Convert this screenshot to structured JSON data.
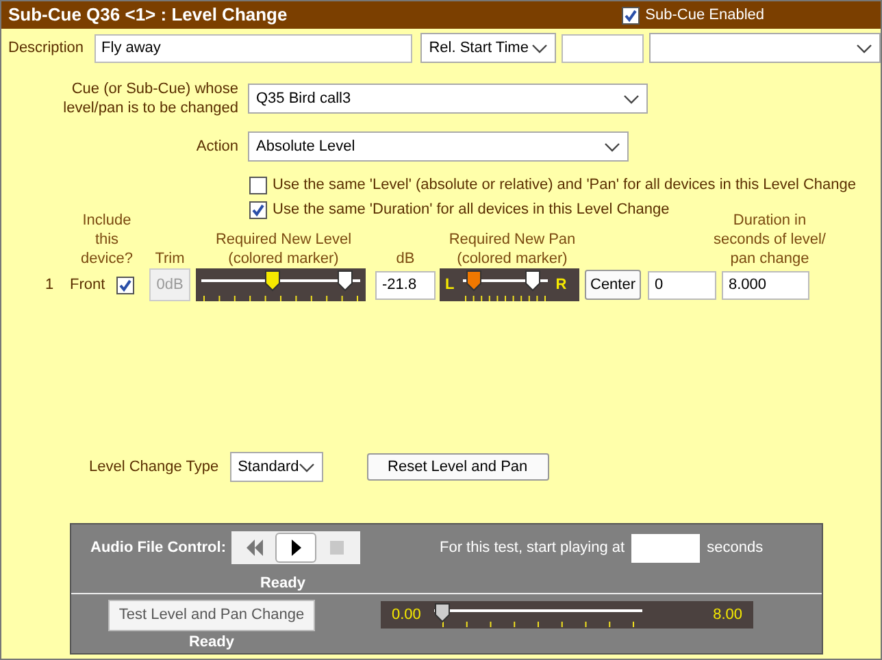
{
  "window": {
    "title": "Sub-Cue Q36 <1> : Level Change"
  },
  "enabled": {
    "label": "Sub-Cue Enabled",
    "checked": true
  },
  "description": {
    "label": "Description",
    "value": "Fly away"
  },
  "start": {
    "mode": "Rel. Start Time"
  },
  "cue": {
    "label": "Cue (or Sub-Cue) whose level/pan is to be changed",
    "value": "Q35  Bird call3"
  },
  "action": {
    "label": "Action",
    "value": "Absolute Level"
  },
  "options": [
    {
      "label": "Use the same 'Level' (absolute or relative) and 'Pan' for all devices in this Level Change",
      "checked": false
    },
    {
      "label": "Use the same 'Duration' for all devices in this Level Change",
      "checked": true
    }
  ],
  "columns": [
    "Include this device?",
    "Trim",
    "Required New Level (colored marker)",
    "dB",
    "Required New Pan (colored marker)",
    "Duration in seconds of level/ pan change"
  ],
  "devices": [
    {
      "number": "1",
      "name": "Front",
      "included": true,
      "trim": "0dB",
      "new_level": {
        "level": 0.45
      },
      "current_level": {
        "level": 0.92
      },
      "db": "-21.8",
      "pan_left": "L",
      "pan_right": "R",
      "new_pan": {
        "level": 0.1
      },
      "current_pan": {
        "level": 0.85
      },
      "center_button": "Center",
      "pan_value": "0",
      "duration": "8.000"
    }
  ],
  "level_change_type": {
    "label": "Level Change Type",
    "value": "Standard"
  },
  "reset_button": "Reset Level and Pan",
  "test": {
    "audio_label": "Audio File Control:",
    "transport": [
      {
        "kind": "rewind",
        "disabled": false
      },
      {
        "kind": "play",
        "disabled": false
      },
      {
        "kind": "stop",
        "disabled": true
      }
    ],
    "audio_status": "Ready",
    "start_label": "For this test, start playing at",
    "start_unit": "seconds",
    "test_button": "Test Level and Pan Change",
    "test_status": "Ready",
    "progress": {
      "start": "0.00",
      "end": "8.00",
      "level": 0
    }
  }
}
